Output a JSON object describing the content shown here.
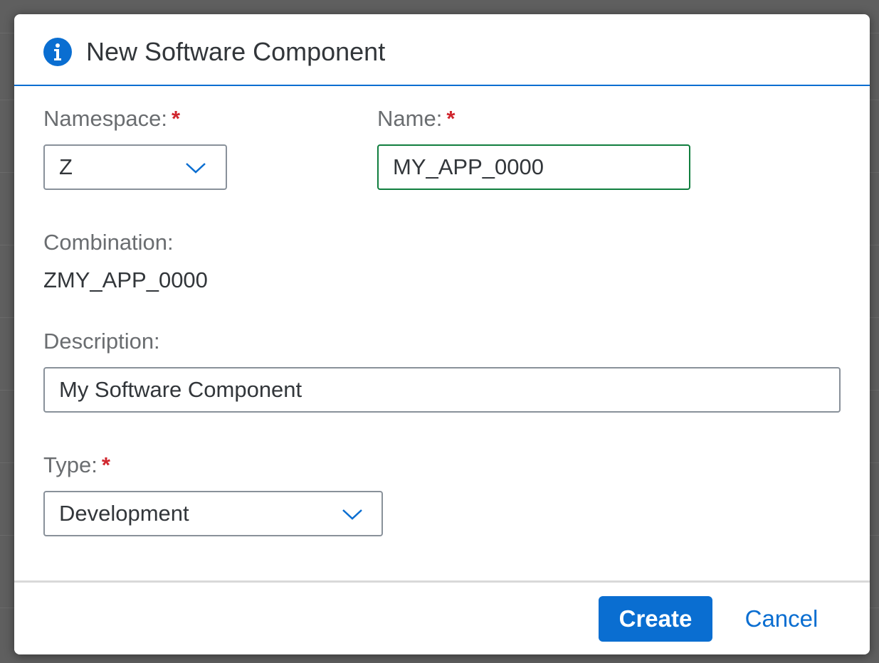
{
  "dialog": {
    "title": "New Software Component",
    "icon": "info-icon"
  },
  "form": {
    "namespace": {
      "label": "Namespace:",
      "required_mark": "*",
      "value": "Z"
    },
    "name": {
      "label": "Name:",
      "required_mark": "*",
      "value": "MY_APP_0000"
    },
    "combination": {
      "label": "Combination:",
      "value": "ZMY_APP_0000"
    },
    "description": {
      "label": "Description:",
      "value": "My Software Component"
    },
    "type": {
      "label": "Type:",
      "required_mark": "*",
      "value": "Development"
    }
  },
  "footer": {
    "create_label": "Create",
    "cancel_label": "Cancel"
  },
  "colors": {
    "accent": "#0a6ed1",
    "required": "#d0262e",
    "valid_border": "#107e3e",
    "overlay": "#5f5f5f"
  }
}
